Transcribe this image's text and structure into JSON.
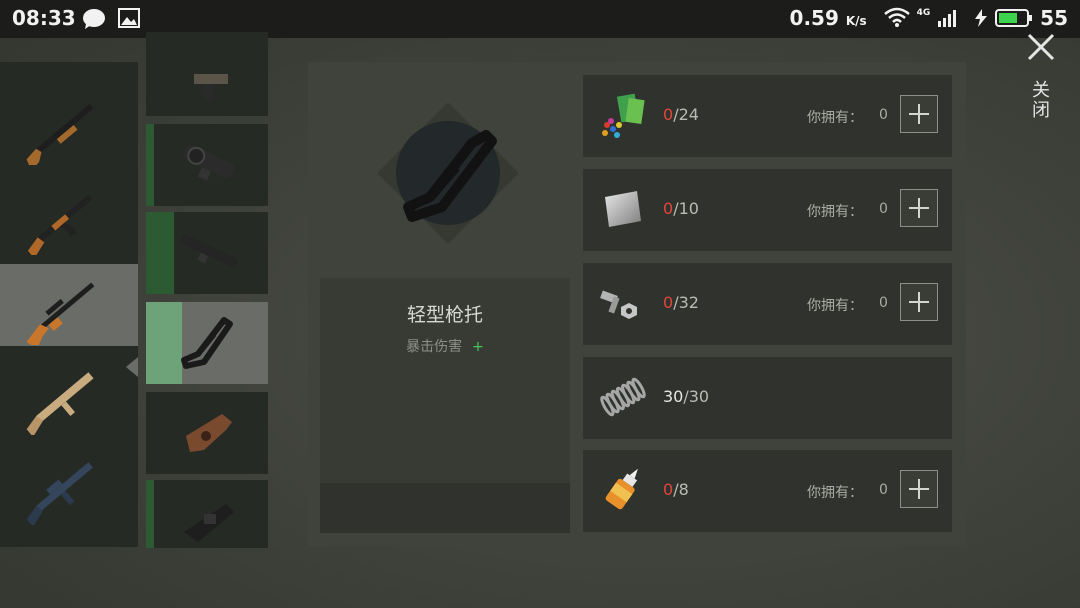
{
  "status_bar": {
    "time": "08:33",
    "speed": "0.59",
    "speed_unit": "K/s",
    "network": "4G",
    "battery": "55",
    "icons": [
      "chat-icon",
      "image-icon",
      "wifi-icon",
      "signal-icon",
      "charging-icon",
      "battery-icon"
    ]
  },
  "weapons": [
    {
      "name": "shotgun-icon"
    },
    {
      "name": "ak-rifle-icon"
    },
    {
      "name": "sniper-rifle-icon",
      "selected": true
    },
    {
      "name": "tan-rifle-icon"
    },
    {
      "name": "m4-rifle-icon"
    }
  ],
  "attachments": [
    {
      "name": "scope-mount-icon"
    },
    {
      "name": "red-dot-scope-icon",
      "progress": 0.08
    },
    {
      "name": "long-scope-icon",
      "progress": 0.23
    },
    {
      "name": "stock-icon",
      "progress": 0.3,
      "selected": true
    },
    {
      "name": "wooden-stock-icon"
    },
    {
      "name": "black-stock-icon",
      "progress": 0.08
    }
  ],
  "selected_item": {
    "name": "轻型枪托",
    "stat_label": "暴击伤害",
    "stat_sign": "+"
  },
  "materials": [
    {
      "icon": "cloth-and-tools-icon",
      "have": "0",
      "need": "/24",
      "own_label": "你拥有：",
      "own_value": "0",
      "can_add": true
    },
    {
      "icon": "metal-plate-icon",
      "have": "0",
      "need": "/10",
      "own_label": "你拥有：",
      "own_value": "0",
      "can_add": true
    },
    {
      "icon": "bolts-nuts-icon",
      "have": "0",
      "need": "/32",
      "own_label": "你拥有：",
      "own_value": "0",
      "can_add": true
    },
    {
      "icon": "spring-icon",
      "have": "30",
      "need": "/30",
      "sufficient": true,
      "can_add": false
    },
    {
      "icon": "glue-icon",
      "have": "0",
      "need": "/8",
      "own_label": "你拥有：",
      "own_value": "0",
      "can_add": true
    }
  ],
  "close": {
    "label": "关闭"
  },
  "colors": {
    "accent_green": "#45c85a",
    "shortage_red": "#e1463e",
    "selected_bg": "#6a6d67"
  }
}
